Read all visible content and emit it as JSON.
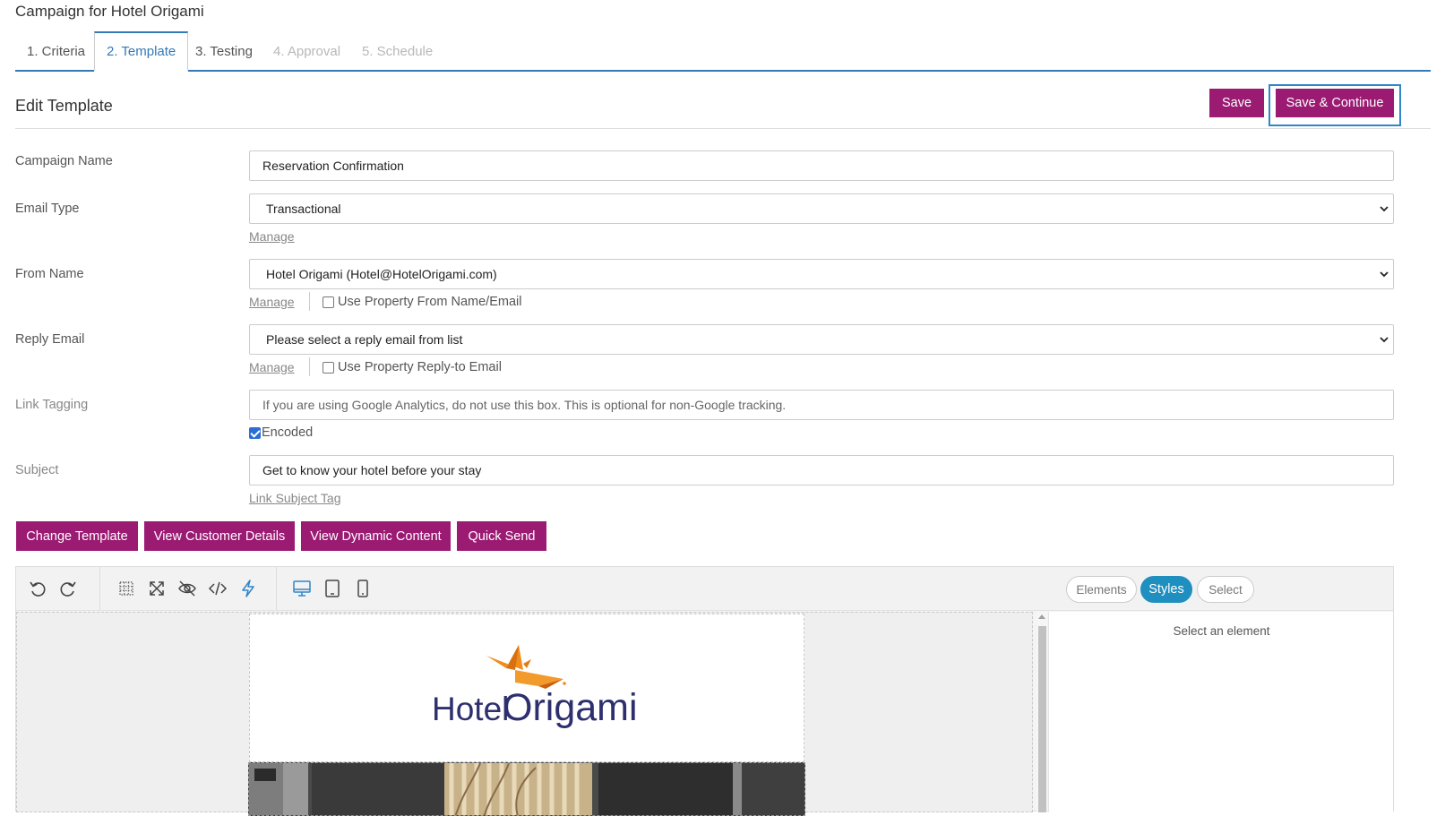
{
  "page": {
    "title": "Campaign for Hotel Origami"
  },
  "tabs": [
    {
      "label": "1. Criteria",
      "state": "done"
    },
    {
      "label": "2. Template",
      "state": "active"
    },
    {
      "label": "3. Testing",
      "state": "done"
    },
    {
      "label": "4. Approval",
      "state": "disabled"
    },
    {
      "label": "5. Schedule",
      "state": "disabled"
    }
  ],
  "section": {
    "title": "Edit Template"
  },
  "actions": {
    "save": "Save",
    "save_continue": "Save & Continue"
  },
  "form": {
    "campaign_name": {
      "label": "Campaign Name",
      "value": "Reservation Confirmation"
    },
    "email_type": {
      "label": "Email Type",
      "value": "Transactional",
      "manage": "Manage"
    },
    "from_name": {
      "label": "From Name",
      "value": "Hotel Origami (Hotel@HotelOrigami.com)",
      "manage": "Manage",
      "checkbox_label": "Use Property From Name/Email",
      "checked": false
    },
    "reply_email": {
      "label": "Reply Email",
      "value": "Please select a reply email from list",
      "manage": "Manage",
      "checkbox_label": "Use Property Reply-to Email",
      "checked": false
    },
    "link_tagging": {
      "label": "Link Tagging",
      "placeholder": "If you are using Google Analytics, do not use this box. This is optional for non-Google tracking.",
      "checkbox_label": "Encoded",
      "checked": true
    },
    "subject": {
      "label": "Subject",
      "value": "Get to know your hotel before your stay",
      "link": "Link Subject Tag"
    }
  },
  "buttons": {
    "change_template": "Change Template",
    "view_customer_details": "View Customer Details",
    "view_dynamic_content": "View Dynamic Content",
    "quick_send": "Quick Send"
  },
  "editor": {
    "toolbar_icons": [
      "undo-icon",
      "redo-icon",
      "grid-icon",
      "fullscreen-icon",
      "preview-hidden-icon",
      "code-icon",
      "lightning-icon",
      "desktop-icon",
      "tablet-icon",
      "mobile-icon"
    ],
    "panel_tabs": [
      "Elements",
      "Styles",
      "Select"
    ],
    "active_panel_tab": "Styles",
    "panel_message": "Select an element"
  },
  "email_preview": {
    "logo_text_1": "Hotel",
    "logo_text_2": "Origami"
  },
  "colors": {
    "primary": "#9b1b73",
    "accent": "#337ab7",
    "pill_active": "#1f8fc0",
    "logo_navy": "#2d2f6e",
    "logo_orange": "#f28c1a"
  }
}
